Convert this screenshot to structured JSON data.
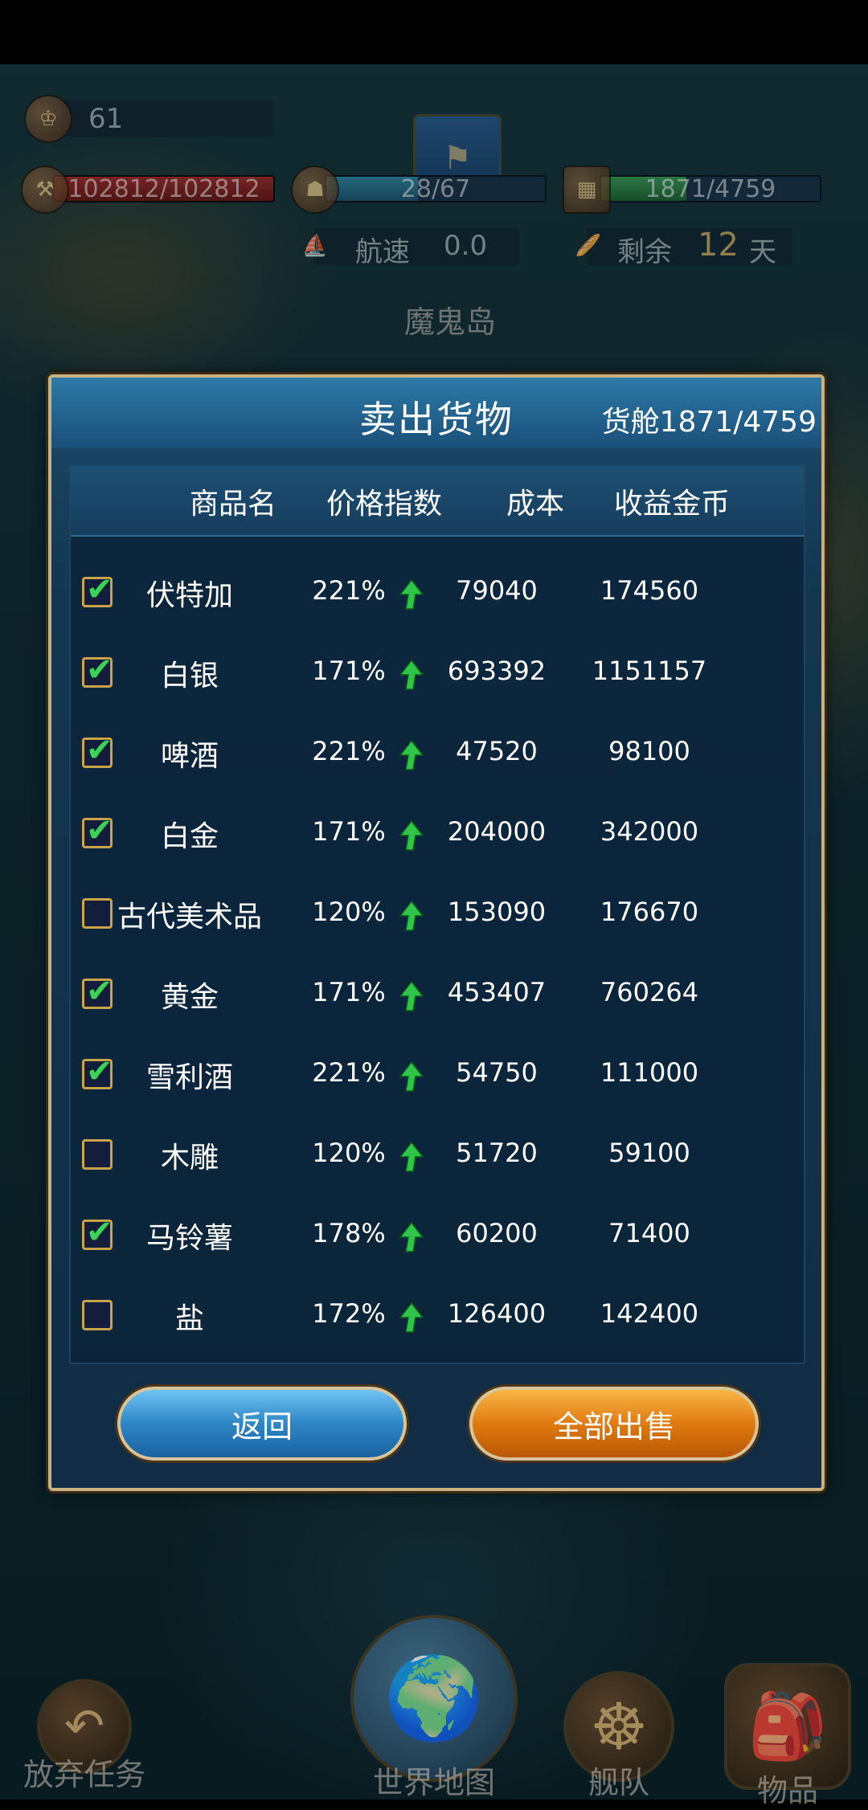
{
  "hud": {
    "level": "61",
    "hp": "102812/102812",
    "crew": "28/67",
    "cargo": "1871/4759",
    "speed_label": "航速",
    "speed_value": "0.0",
    "remaining_label": "剩余",
    "remaining_days": "12",
    "remaining_unit": "天",
    "location": "魔鬼岛",
    "hp_fill": 1.0,
    "crew_fill": 0.42,
    "cargo_fill": 0.39
  },
  "dialog": {
    "title": "卖出货物",
    "cargo_label": "货舱1871/4759",
    "headers": {
      "name": "商品名",
      "price_index": "价格指数",
      "cost": "成本",
      "profit": "收益金币"
    },
    "rows": [
      {
        "name": "伏特加",
        "checked": true,
        "pct": "221%",
        "cost": "79040",
        "profit": "174560"
      },
      {
        "name": "白银",
        "checked": true,
        "pct": "171%",
        "cost": "693392",
        "profit": "1151157"
      },
      {
        "name": "啤酒",
        "checked": true,
        "pct": "221%",
        "cost": "47520",
        "profit": "98100"
      },
      {
        "name": "白金",
        "checked": true,
        "pct": "171%",
        "cost": "204000",
        "profit": "342000"
      },
      {
        "name": "古代美术品",
        "checked": false,
        "pct": "120%",
        "cost": "153090",
        "profit": "176670"
      },
      {
        "name": "黄金",
        "checked": true,
        "pct": "171%",
        "cost": "453407",
        "profit": "760264"
      },
      {
        "name": "雪利酒",
        "checked": true,
        "pct": "221%",
        "cost": "54750",
        "profit": "111000"
      },
      {
        "name": "木雕",
        "checked": false,
        "pct": "120%",
        "cost": "51720",
        "profit": "59100"
      },
      {
        "name": "马铃薯",
        "checked": true,
        "pct": "178%",
        "cost": "60200",
        "profit": "71400"
      },
      {
        "name": "盐",
        "checked": false,
        "pct": "172%",
        "cost": "126400",
        "profit": "142400"
      }
    ],
    "back_label": "返回",
    "sell_all_label": "全部出售"
  },
  "nav": {
    "abandon": "放弃任务",
    "world_map": "世界地图",
    "fleet": "舰队",
    "items": "物品"
  },
  "colors": {
    "check": "#3bd45a",
    "arrow": "#2fc54a",
    "frame": "#c9b080"
  }
}
